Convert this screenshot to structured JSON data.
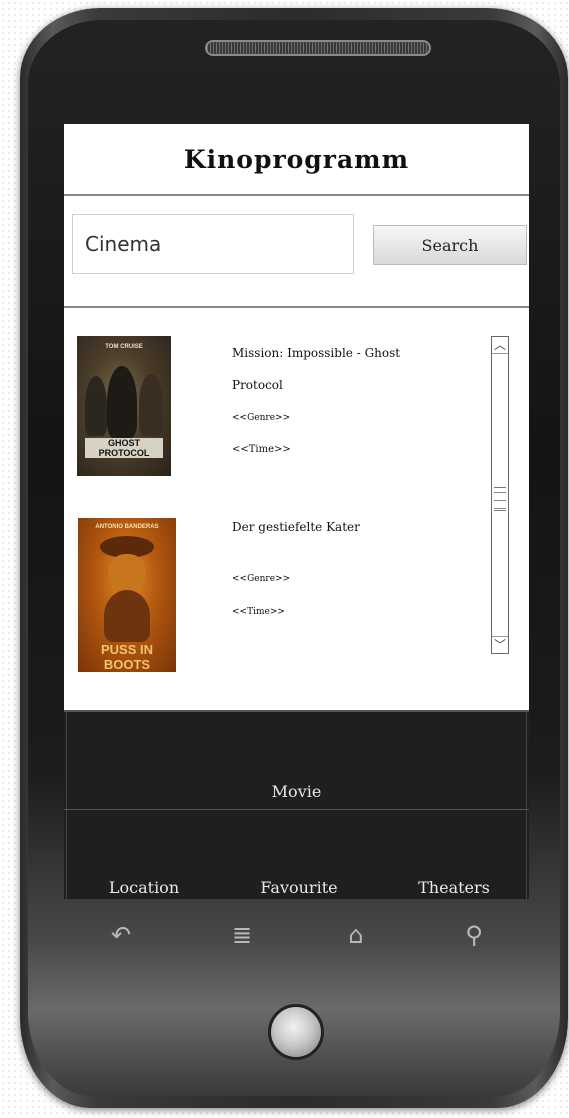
{
  "header": {
    "title": "Kinoprogramm"
  },
  "search": {
    "value": "Cinema",
    "button_label": "Search"
  },
  "movies": [
    {
      "title_line1": "Mission: Impossible - Ghost",
      "title_line2": "Protocol",
      "genre": "<<Genre>>",
      "time": "<<Time>>",
      "poster_text": "GHOST PROTOCOL",
      "poster_top_text": "TOM CRUISE"
    },
    {
      "title_line1": "Der gestiefelte Kater",
      "genre": "<<Genre>>",
      "time": "<<Time>>",
      "poster_text": "PUSS IN BOOTS",
      "poster_top_text": "ANTONIO BANDERAS"
    }
  ],
  "bottom_nav": {
    "movie": "Movie",
    "location": "Location",
    "favourite": "Favourite",
    "theaters": "Theaters"
  },
  "icons": {
    "back": "back-icon",
    "menu": "menu-icon",
    "home": "home-icon",
    "search": "search-icon"
  },
  "colors": {
    "bottom_bar": "#1f1f1f",
    "screen": "#ffffff"
  }
}
